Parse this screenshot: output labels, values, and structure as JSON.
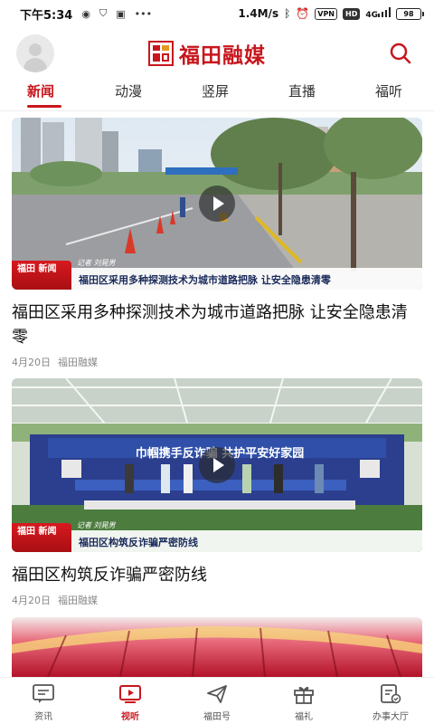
{
  "status_bar": {
    "time": "下午5:34",
    "speed": "1.4M/s",
    "vpn": "VPN",
    "hd": "HD",
    "network": "4G",
    "battery": "98"
  },
  "header": {
    "brand": "福田融媒"
  },
  "tabs": [
    {
      "label": "新闻",
      "active": true
    },
    {
      "label": "动漫",
      "active": false
    },
    {
      "label": "竖屏",
      "active": false
    },
    {
      "label": "直播",
      "active": false
    },
    {
      "label": "福听",
      "active": false
    }
  ],
  "feed": [
    {
      "title": "福田区采用多种探测技术为城市道路把脉 让安全隐患清零",
      "date": "4月20日",
      "source": "福田融媒",
      "badge": "福田 新闻",
      "reporter": "记者 刘晃男",
      "caption": "福田区采用多种探测技术为城市道路把脉 让安全隐患清零"
    },
    {
      "title": "福田区构筑反诈骗严密防线",
      "date": "4月20日",
      "source": "福田融媒",
      "badge": "福田 新闻",
      "reporter": "记者 刘晃男",
      "caption": "福田区构筑反诈骗严密防线",
      "banner": "巾帼携手反诈骗 共护平安好家园"
    }
  ],
  "bottom_nav": [
    {
      "label": "资讯",
      "icon": "news-icon",
      "active": false
    },
    {
      "label": "视听",
      "icon": "video-icon",
      "active": true
    },
    {
      "label": "福田号",
      "icon": "send-icon",
      "active": false
    },
    {
      "label": "福礼",
      "icon": "gift-icon",
      "active": false
    },
    {
      "label": "办事大厅",
      "icon": "service-icon",
      "active": false
    }
  ],
  "colors": {
    "accent": "#c8161d",
    "text": "#111111",
    "meta": "#888888"
  }
}
